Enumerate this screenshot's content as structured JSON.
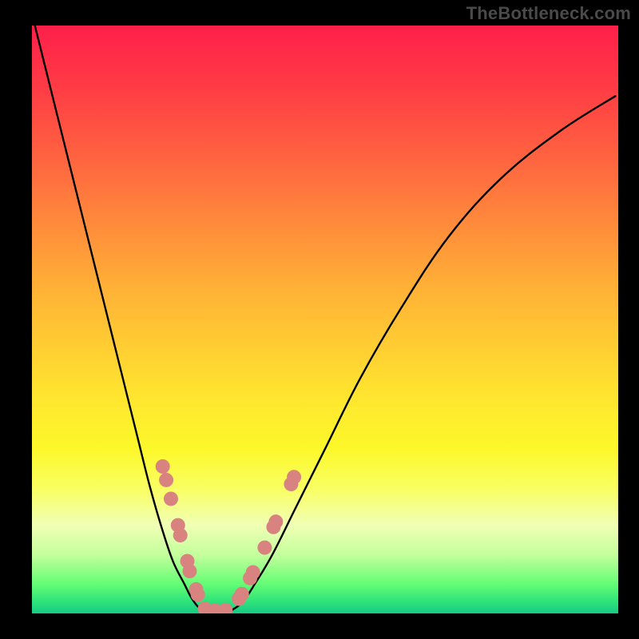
{
  "watermark": {
    "text": "TheBottleneck.com"
  },
  "colors": {
    "background": "#000000",
    "curve": "#000000",
    "marker": "#d98381",
    "gradient_top": "#ff1f4a",
    "gradient_bottom": "#18c985"
  },
  "chart_data": {
    "type": "line",
    "title": "",
    "xlabel": "",
    "ylabel": "",
    "xlim": [
      0,
      100
    ],
    "ylim": [
      0,
      100
    ],
    "note": "No axes, ticks, or numeric labels are shown; values are percentages of the plot area estimated from pixel positions. y=0 is the bottom (green) edge, y=100 the top (red) edge.",
    "series": [
      {
        "name": "left-branch",
        "x": [
          0.5,
          3,
          6,
          9,
          12,
          15,
          18,
          20,
          22,
          24,
          26,
          27,
          28,
          29
        ],
        "y": [
          100,
          90,
          78,
          66,
          54,
          42,
          30,
          22,
          15,
          9,
          5,
          3,
          1.5,
          0.5
        ]
      },
      {
        "name": "right-branch",
        "x": [
          34,
          36,
          38,
          41,
          45,
          50,
          56,
          63,
          71,
          80,
          90,
          99.5
        ],
        "y": [
          0.5,
          2,
          5,
          10,
          18,
          28,
          40,
          52,
          64,
          74,
          82,
          88
        ]
      }
    ],
    "markers": [
      {
        "branch": "left",
        "x": 22.3,
        "y": 25.0
      },
      {
        "branch": "left",
        "x": 22.9,
        "y": 22.7
      },
      {
        "branch": "left",
        "x": 23.7,
        "y": 19.5
      },
      {
        "branch": "left",
        "x": 24.9,
        "y": 15.0
      },
      {
        "branch": "left",
        "x": 25.3,
        "y": 13.3
      },
      {
        "branch": "left",
        "x": 26.5,
        "y": 8.9
      },
      {
        "branch": "left",
        "x": 26.9,
        "y": 7.2
      },
      {
        "branch": "left",
        "x": 28.0,
        "y": 4.1
      },
      {
        "branch": "left",
        "x": 28.3,
        "y": 3.2
      },
      {
        "branch": "flat",
        "x": 29.5,
        "y": 0.8
      },
      {
        "branch": "flat",
        "x": 31.2,
        "y": 0.5
      },
      {
        "branch": "flat",
        "x": 33.0,
        "y": 0.6
      },
      {
        "branch": "right",
        "x": 35.3,
        "y": 2.5
      },
      {
        "branch": "right",
        "x": 35.8,
        "y": 3.3
      },
      {
        "branch": "right",
        "x": 37.2,
        "y": 6.0
      },
      {
        "branch": "right",
        "x": 37.7,
        "y": 7.0
      },
      {
        "branch": "right",
        "x": 39.7,
        "y": 11.2
      },
      {
        "branch": "right",
        "x": 41.2,
        "y": 14.7
      },
      {
        "branch": "right",
        "x": 41.6,
        "y": 15.6
      },
      {
        "branch": "right",
        "x": 44.2,
        "y": 22.0
      },
      {
        "branch": "right",
        "x": 44.7,
        "y": 23.2
      }
    ],
    "marker_radius_px": 9
  }
}
